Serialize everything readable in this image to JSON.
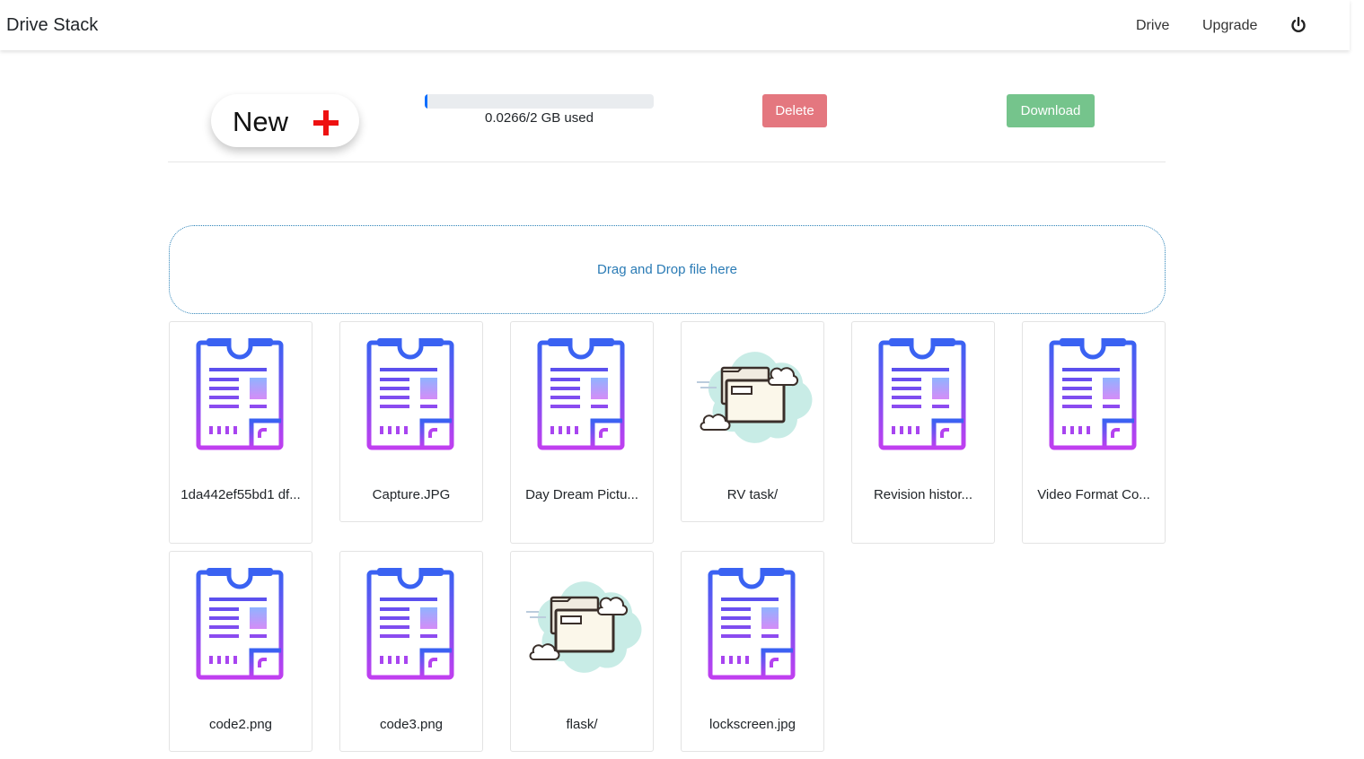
{
  "navbar": {
    "brand": "Drive Stack",
    "links": [
      {
        "label": "Drive"
      },
      {
        "label": "Upgrade"
      }
    ],
    "power_icon": "power-icon"
  },
  "toolbar": {
    "new_label": "New",
    "new_icon": "plus-icon",
    "storage": {
      "used_fraction": 0.0133,
      "text": "0.0266/2 GB used"
    },
    "delete_label": "Delete",
    "download_label": "Download"
  },
  "dropzone": {
    "text": "Drag and Drop file here"
  },
  "files": [
    {
      "name": "1da442ef55bd1 df...",
      "kind": "file"
    },
    {
      "name": "Capture.JPG",
      "kind": "file"
    },
    {
      "name": "Day Dream Pictu...",
      "kind": "file"
    },
    {
      "name": "RV task/",
      "kind": "folder"
    },
    {
      "name": "Revision histor...",
      "kind": "file"
    },
    {
      "name": "Video Format Co...",
      "kind": "file"
    },
    {
      "name": "code2.png",
      "kind": "file"
    },
    {
      "name": "code3.png",
      "kind": "file"
    },
    {
      "name": "flask/",
      "kind": "folder"
    },
    {
      "name": "lockscreen.jpg",
      "kind": "file"
    }
  ],
  "colors": {
    "accent": "#0d6efd",
    "delete": "#e4777f",
    "download": "#75c48c",
    "dropzone_border": "#2b82b8",
    "file_icon_top": "#3a62f2",
    "file_icon_bottom": "#c03ff0"
  }
}
